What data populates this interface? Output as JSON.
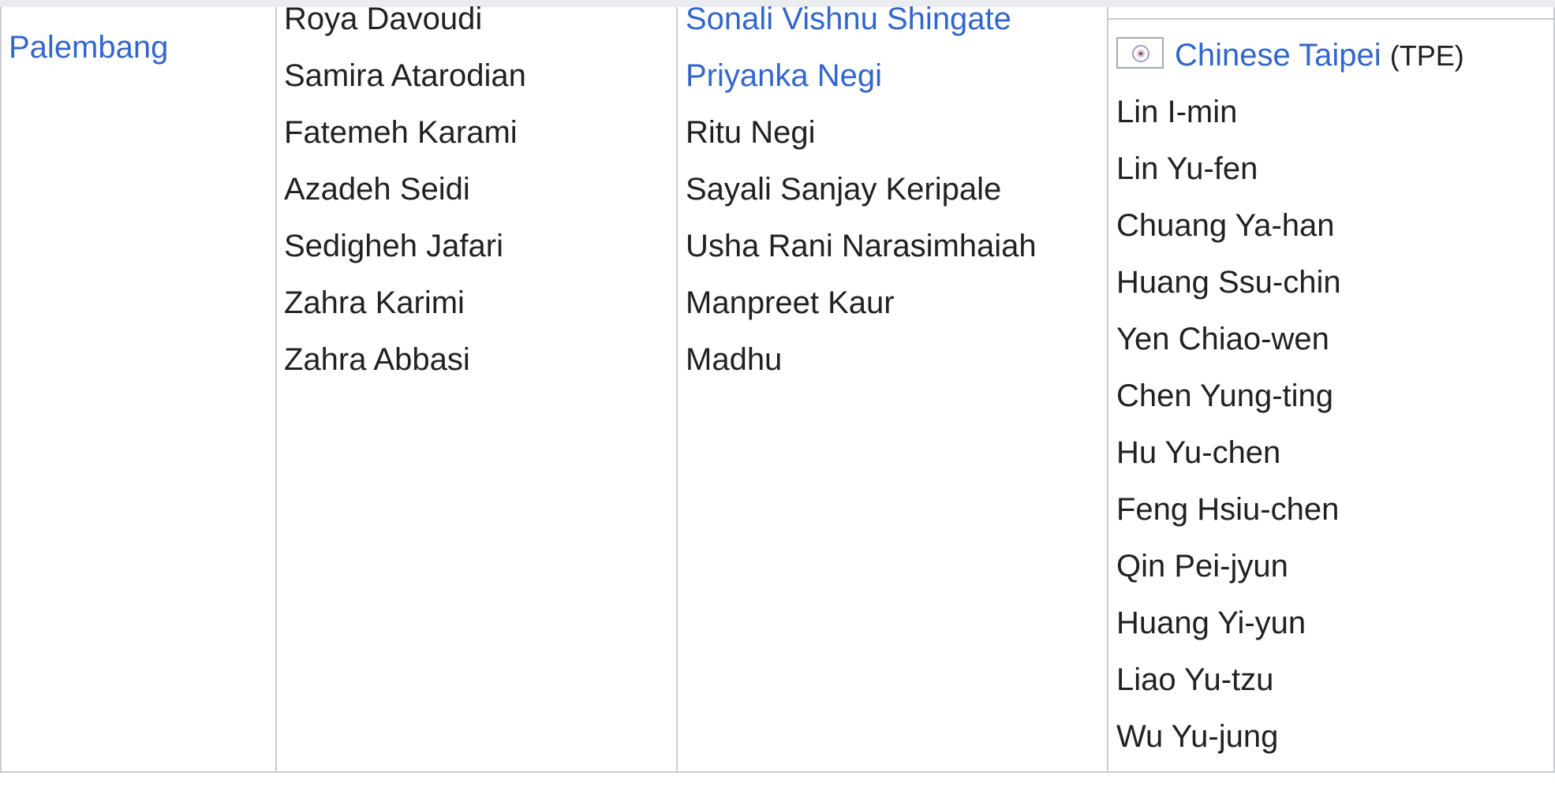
{
  "venue": {
    "label": "Palembang"
  },
  "columns": {
    "col1": [
      {
        "name": "Roya Davoudi",
        "link": false
      },
      {
        "name": "Samira Atarodian",
        "link": false
      },
      {
        "name": "Fatemeh Karami",
        "link": false
      },
      {
        "name": "Azadeh Seidi",
        "link": false
      },
      {
        "name": "Sedigheh Jafari",
        "link": false
      },
      {
        "name": "Zahra Karimi",
        "link": false
      },
      {
        "name": "Zahra Abbasi",
        "link": false
      }
    ],
    "col2": [
      {
        "name": "Sonali Vishnu Shingate",
        "link": true
      },
      {
        "name": "Priyanka Negi",
        "link": true
      },
      {
        "name": "Ritu Negi",
        "link": false
      },
      {
        "name": "Sayali Sanjay Keripale",
        "link": false
      },
      {
        "name": "Usha Rani Narasimhaiah",
        "link": false
      },
      {
        "name": "Manpreet Kaur",
        "link": false
      },
      {
        "name": "Madhu",
        "link": false
      }
    ],
    "col3": {
      "team": "Chinese Taipei",
      "code": "(TPE)",
      "flag_icon": "chinese-taipei-olympic-flag-icon",
      "players": [
        "Lin I-min",
        "Lin Yu-fen",
        "Chuang Ya-han",
        "Huang Ssu-chin",
        "Yen Chiao-wen",
        "Chen Yung-ting",
        "Hu Yu-chen",
        "Feng Hsiu-chen",
        "Qin Pei-jyun",
        "Huang Yi-yun",
        "Liao Yu-tzu",
        "Wu Yu-jung"
      ]
    }
  },
  "colors": {
    "link": "#3366cc",
    "text": "#202122",
    "border": "#c8ccd1"
  }
}
